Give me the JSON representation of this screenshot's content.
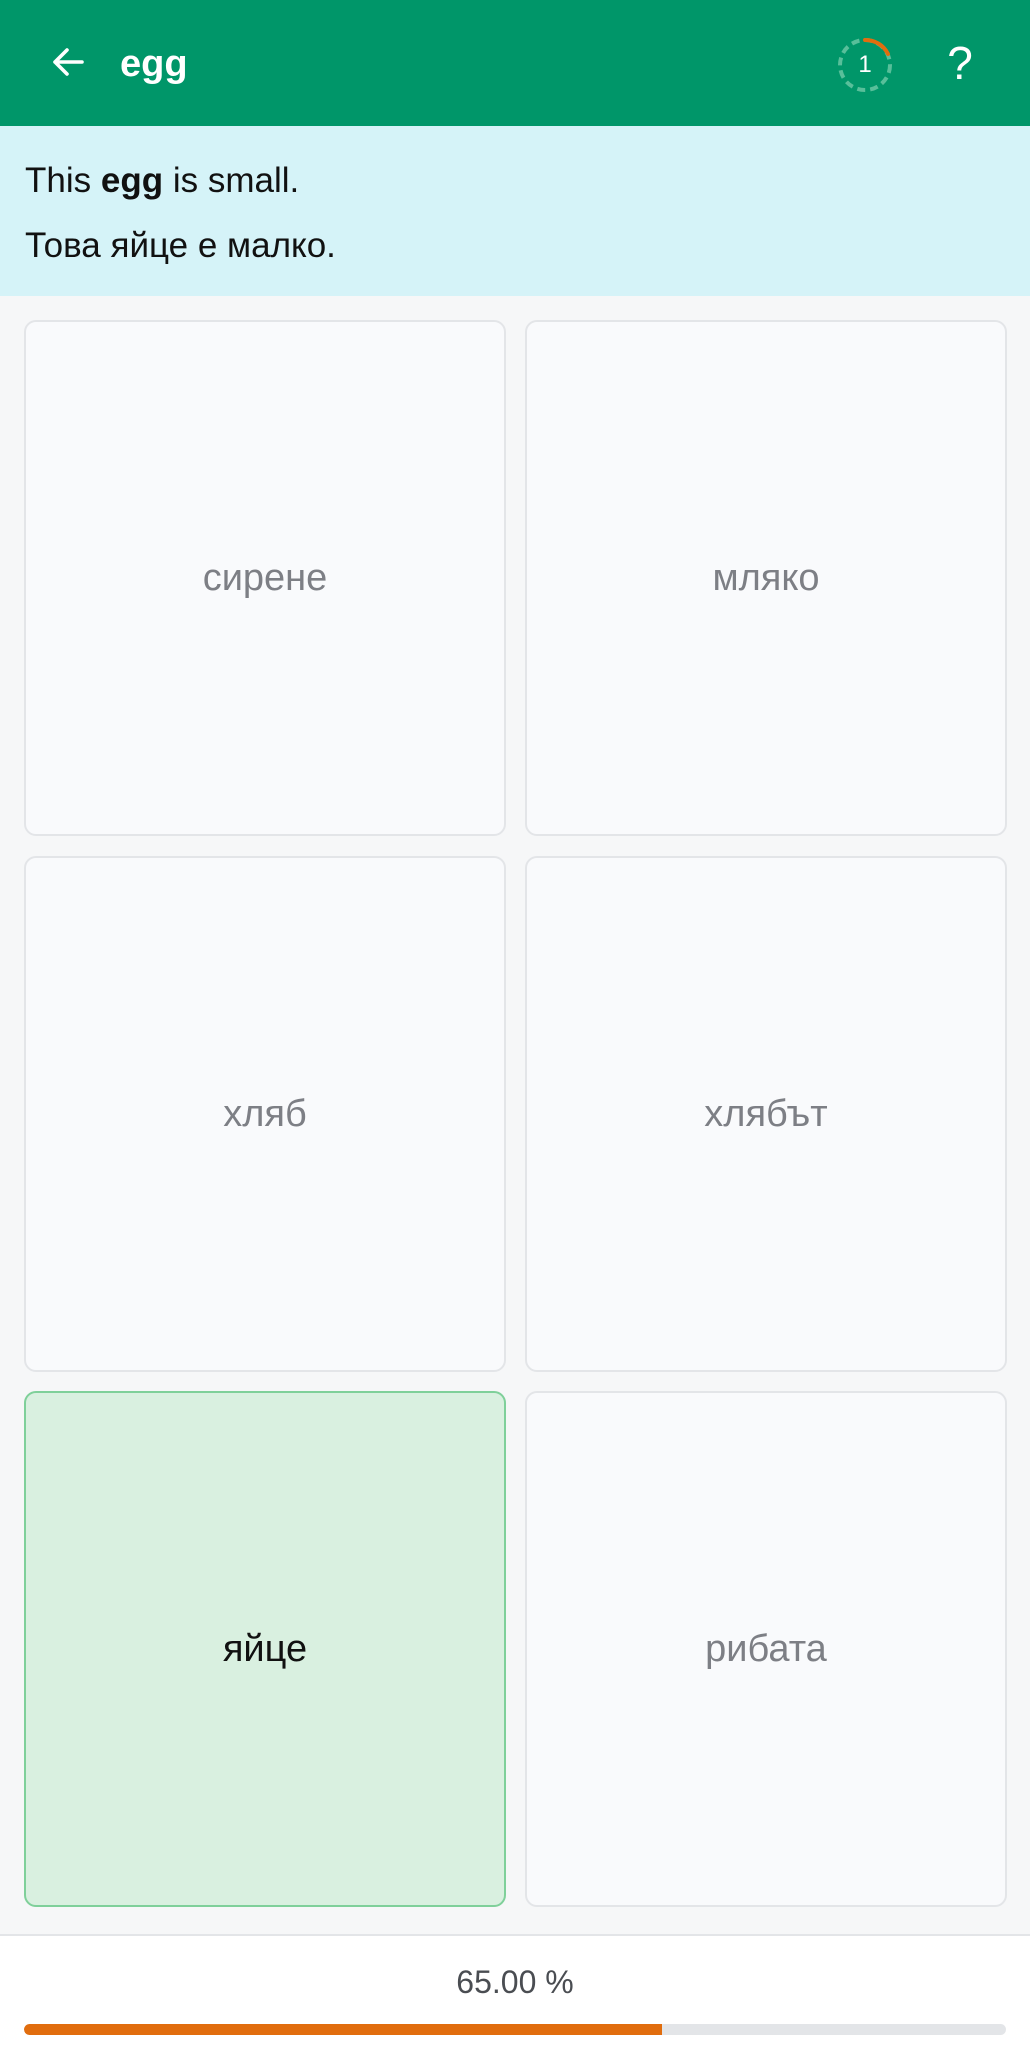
{
  "header": {
    "title": "egg",
    "back_icon": "arrow-left-icon",
    "progress_count": "1",
    "help_label": "?",
    "ring_colors": {
      "active": "#e16d0e",
      "inactive": "#58bf9a"
    }
  },
  "sentence": {
    "english_prefix": "This ",
    "english_word": "egg",
    "english_suffix": " is small.",
    "bulgarian": "Това яйце е малко."
  },
  "options": [
    {
      "label": "сирене",
      "state": "default"
    },
    {
      "label": "мляко",
      "state": "default"
    },
    {
      "label": "хляб",
      "state": "default"
    },
    {
      "label": "хлябът",
      "state": "default"
    },
    {
      "label": "яйце",
      "state": "correct"
    },
    {
      "label": "рибата",
      "state": "default"
    }
  ],
  "footer": {
    "progress_text": "65.00 %",
    "progress_value": 0.65
  },
  "colors": {
    "header_bg": "#009669",
    "sentence_bg": "#d5f3f8",
    "correct_bg": "#d9f0e0",
    "correct_border": "#7fd09a",
    "progress_fill": "#e16d0e"
  }
}
